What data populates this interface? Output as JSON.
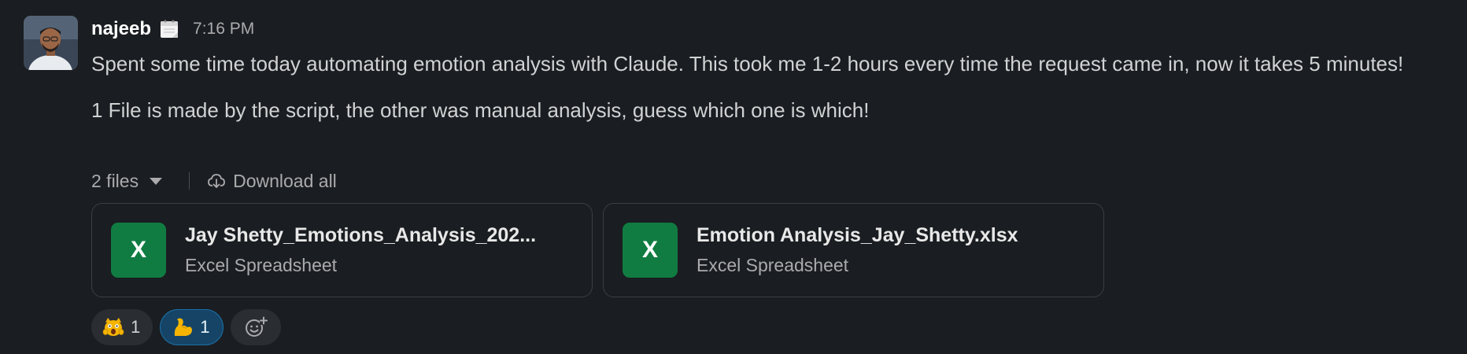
{
  "message": {
    "author": "najeeb",
    "status_emoji": "calendar-emoji",
    "timestamp": "7:16 PM",
    "paragraphs": [
      "Spent some time today automating emotion analysis with Claude. This took me 1-2 hours every time the request came in, now it takes 5 minutes!",
      "1 File is made by the script, the other was manual analysis, guess which one is which!"
    ]
  },
  "files_bar": {
    "count_label": "2 files",
    "download_all_label": "Download all"
  },
  "files": [
    {
      "name": "Jay Shetty_Emotions_Analysis_202...",
      "type": "Excel Spreadsheet",
      "icon_letter": "X",
      "icon_color": "#107c41"
    },
    {
      "name": "Emotion Analysis_Jay_Shetty.xlsx",
      "type": "Excel Spreadsheet",
      "icon_letter": "X",
      "icon_color": "#107c41"
    }
  ],
  "reactions": [
    {
      "emoji": "scream-cat-emoji",
      "count": "1",
      "active": false
    },
    {
      "emoji": "flexed-biceps-emoji",
      "count": "1",
      "active": true
    }
  ],
  "colors": {
    "background": "#1a1d21",
    "text": "#d1d2d3",
    "muted": "#ababad",
    "excel_green": "#107c41",
    "active_reaction_bg": "#154467",
    "active_reaction_border": "#1d6fa5"
  }
}
